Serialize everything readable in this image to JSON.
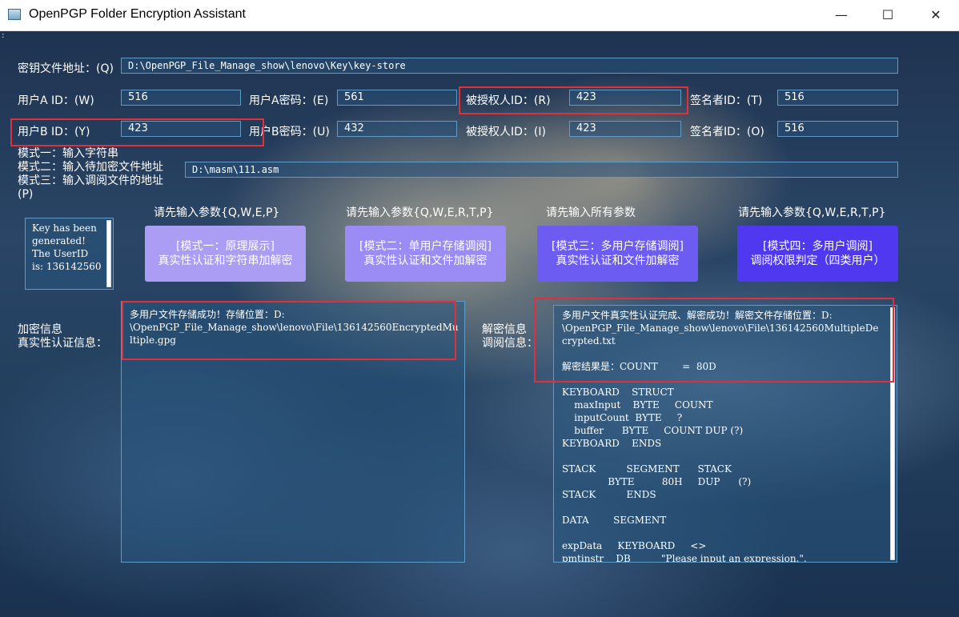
{
  "window": {
    "title": "OpenPGP Folder Encryption Assistant",
    "minimize": "—",
    "maximize": "☐",
    "close": "✕"
  },
  "menu_grip": ":",
  "key_path": {
    "label": "密钥文件地址：(Q)",
    "value": "D:\\OpenPGP_File_Manage_show\\lenovo\\Key\\key-store"
  },
  "row1": {
    "user_a_id_label": "用户A ID：(W)",
    "user_a_id": "516",
    "user_a_pwd_label": "用户A密码：(E)",
    "user_a_pwd": "561",
    "grantee_label": "被授权人ID：(R)",
    "grantee": "423",
    "signer_label": "签名者ID：(T)",
    "signer": "516"
  },
  "row2": {
    "user_b_id_label": "用户B ID：(Y)",
    "user_b_id": "423",
    "user_b_pwd_label": "用户B密码：(U)",
    "user_b_pwd": "432",
    "grantee_label": "被授权人ID：(I)",
    "grantee": "423",
    "signer_label": "签名者ID：(O)",
    "signer": "516"
  },
  "modes": {
    "mode1": "模式一：输入字符串",
    "mode2": "模式二：输入待加密文件地址",
    "mode3": "模式三：输入调阅文件的地址",
    "p_label": "(P)",
    "input_value": "D:\\masm\\111.asm"
  },
  "key_log": "Key has been generated! The UserID is: 136142560",
  "hints": {
    "h1": "请先输入参数{Q,W,E,P}",
    "h2": "请先输入参数{Q,W,E,R,T,P}",
    "h3": "请先输入所有参数",
    "h4": "请先输入参数{Q,W,E,R,T,P}"
  },
  "buttons": {
    "b1_l1": "[模式一：原理展示]",
    "b1_l2": "真实性认证和字符串加解密",
    "b2_l1": "[模式二：单用户存储调阅]",
    "b2_l2": "真实性认证和文件加解密",
    "b3_l1": "[模式三：多用户存储调阅]",
    "b3_l2": "真实性认证和文件加解密",
    "b4_l1": "[模式四：多用户调阅]",
    "b4_l2": "调阅权限判定（四类用户）"
  },
  "encrypt": {
    "label1": "加密信息",
    "label2": "真实性认证信息：",
    "text": "多用户文件存储成功！存储位置：D:\n\\OpenPGP_File_Manage_show\\lenovo\\File\\136142560EncryptedMu\nltiple.gpg"
  },
  "decrypt": {
    "label1": "解密信息",
    "label2": "调阅信息：",
    "text": "多用户文件真实性认证完成、解密成功！解密文件存储位置：D:\n\\OpenPGP_File_Manage_show\\lenovo\\File\\136142560MultipleDe\ncrypted.txt\n\n解密结果是：COUNT        =  80D\n\nKEYBOARD    STRUCT\n    maxInput    BYTE     COUNT\n    inputCount  BYTE     ?\n    buffer      BYTE     COUNT DUP (?)\nKEYBOARD    ENDS\n\nSTACK          SEGMENT      STACK\n               BYTE         80H     DUP      (?)\nSTACK          ENDS\n\nDATA        SEGMENT\n\nexpData     KEYBOARD     <>\npmtinstr    DB          \"Please input an expression.\","
  }
}
